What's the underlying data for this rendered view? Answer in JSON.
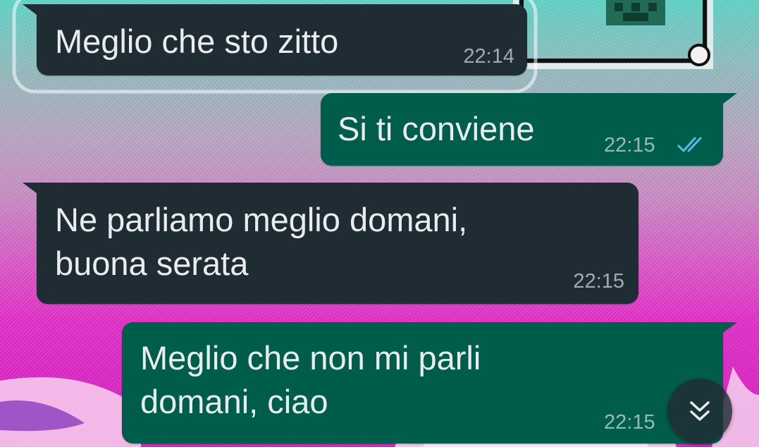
{
  "messages": [
    {
      "direction": "incoming",
      "text": "Meglio che sto zitto",
      "time": "22:14"
    },
    {
      "direction": "outgoing",
      "text": "Si ti conviene",
      "time": "22:15",
      "status": "read",
      "status_icon": "double-check-icon"
    },
    {
      "direction": "incoming",
      "text": "Ne parliamo meglio domani,\nbuona serata",
      "time": "22:15"
    },
    {
      "direction": "outgoing",
      "text": "Meglio che non mi parli\ndomani, ciao",
      "time": "22:15"
    }
  ],
  "scroll_button": {
    "icon": "double-chevron-down-icon"
  },
  "colors": {
    "incoming_bubble": "#202c33",
    "outgoing_bubble": "#005c4b",
    "read_ticks": "#53bdeb",
    "text": "#e9edef"
  }
}
